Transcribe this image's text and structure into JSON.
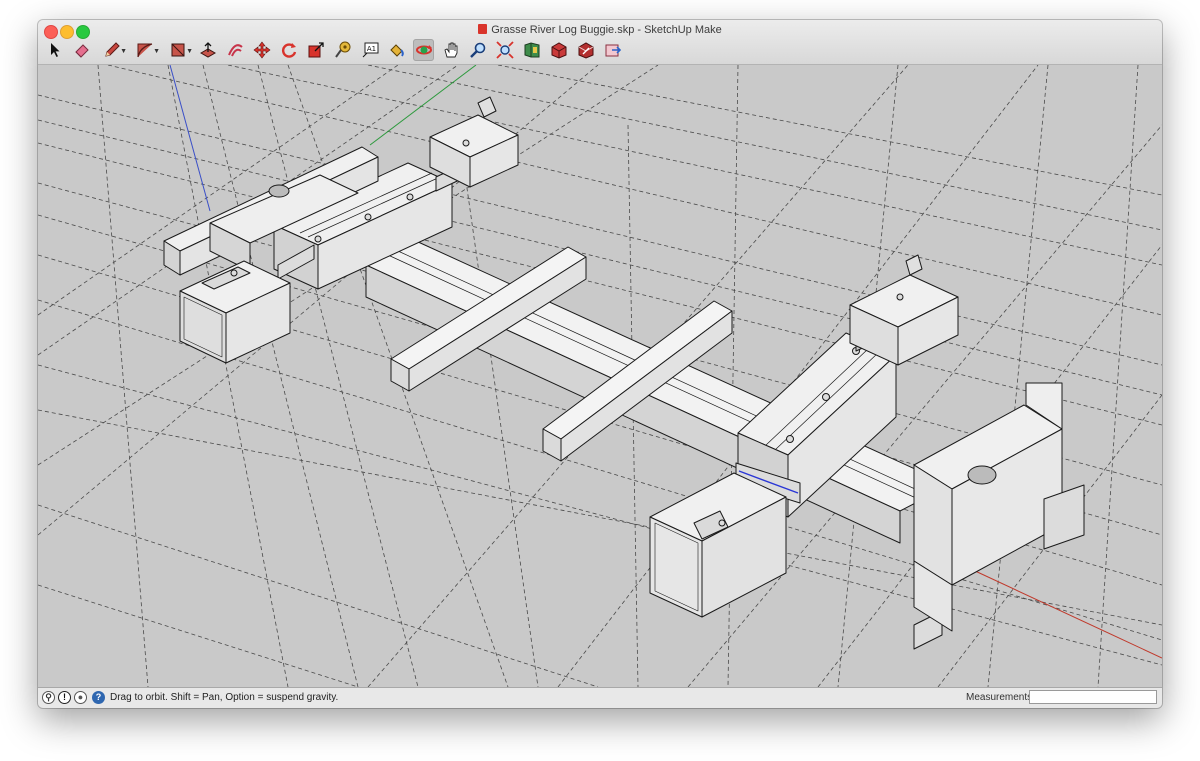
{
  "window": {
    "title": "Grasse River Log Buggie.skp - SketchUp Make"
  },
  "toolbar": {
    "tools": [
      {
        "name": "select",
        "icon": "arrow-cursor-icon"
      },
      {
        "name": "eraser",
        "icon": "eraser-icon"
      },
      {
        "name": "line",
        "icon": "pencil-icon",
        "has_menu": true
      },
      {
        "name": "arc",
        "icon": "arc-icon",
        "has_menu": true
      },
      {
        "name": "shapes",
        "icon": "rectangle-icon",
        "has_menu": true
      },
      {
        "name": "push-pull",
        "icon": "push-pull-icon"
      },
      {
        "name": "offset",
        "icon": "offset-icon"
      },
      {
        "name": "move",
        "icon": "move-icon"
      },
      {
        "name": "rotate",
        "icon": "rotate-icon"
      },
      {
        "name": "scale",
        "icon": "scale-icon"
      },
      {
        "name": "tape-measure",
        "icon": "tape-measure-icon"
      },
      {
        "name": "text",
        "icon": "text-icon",
        "label": "A1"
      },
      {
        "name": "paint-bucket",
        "icon": "paint-bucket-icon"
      },
      {
        "name": "orbit",
        "icon": "orbit-icon",
        "active": true
      },
      {
        "name": "pan",
        "icon": "hand-icon"
      },
      {
        "name": "zoom",
        "icon": "magnifier-icon"
      },
      {
        "name": "zoom-extents",
        "icon": "zoom-extents-icon"
      },
      {
        "name": "3d-warehouse",
        "icon": "warehouse-icon"
      },
      {
        "name": "extension-warehouse",
        "icon": "extension-warehouse-icon"
      },
      {
        "name": "share-model",
        "icon": "share-model-icon"
      },
      {
        "name": "send-to-layout",
        "icon": "layout-icon"
      }
    ]
  },
  "status": {
    "message": "Drag to orbit. Shift = Pan, Option = suspend gravity.",
    "measurements_label": "Measurements",
    "measurements_value": ""
  },
  "colors": {
    "canvas": "#c9c9c9",
    "face": "#efefef",
    "edge": "#1a1a1a",
    "axis_red": "#c0392b",
    "axis_green": "#2e9a3e",
    "axis_blue": "#3a4fc7",
    "guide": "#4a4a4a"
  }
}
